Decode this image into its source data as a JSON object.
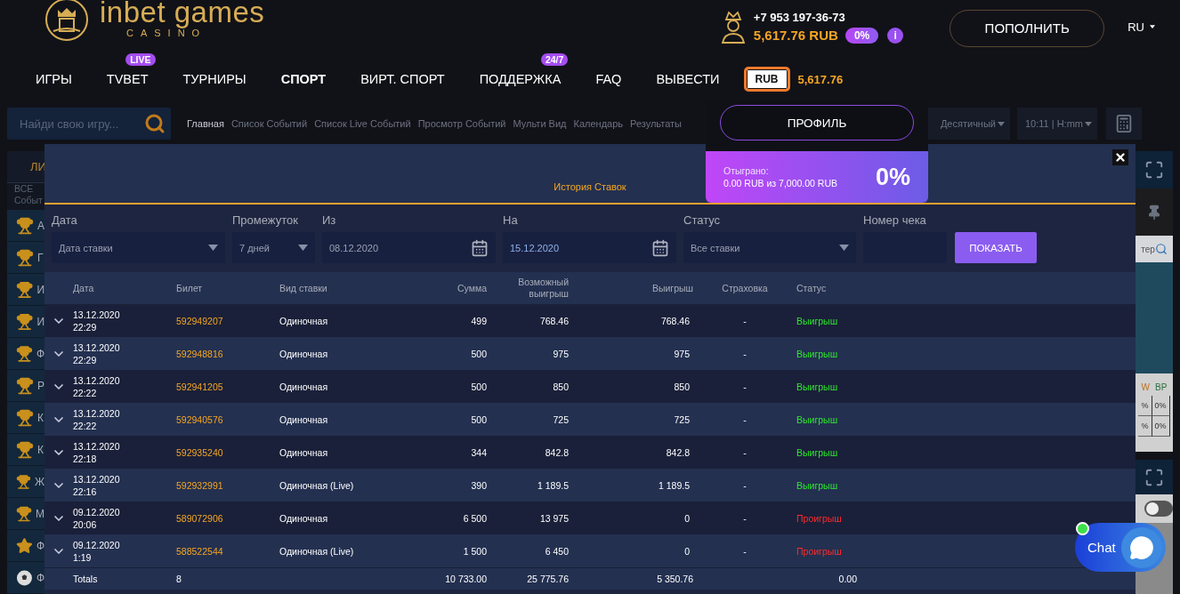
{
  "header": {
    "logo": {
      "name": "inbet games",
      "sub": "CASINO"
    },
    "account": {
      "phone": "+7 953 197-36-73",
      "balance": "5,617.76 RUB",
      "bonus": "0%",
      "info": "i"
    },
    "deposit_button": "ПОПОЛНИТЬ",
    "language": "RU"
  },
  "nav": {
    "items": [
      {
        "label": "ИГРЫ",
        "selected": false
      },
      {
        "label": "TVBET",
        "selected": false,
        "badge": "LIVE"
      },
      {
        "label": "ТУРНИРЫ",
        "selected": false
      },
      {
        "label": "СПОРТ",
        "selected": true
      },
      {
        "label": "ВИРТ. СПОРТ",
        "selected": false
      },
      {
        "label": "ПОДДЕРЖКА",
        "selected": false,
        "badge": "24/7"
      },
      {
        "label": "FAQ",
        "selected": false
      },
      {
        "label": "ВЫВЕСТИ",
        "selected": false
      }
    ],
    "currency_button": "RUB",
    "currency_balance": "5,617.76"
  },
  "subbar": {
    "search": {
      "placeholder": "Найди свою игру..."
    },
    "breadcrumbs": [
      {
        "label": "Главная",
        "selected": true
      },
      {
        "label": "Список Событий",
        "selected": false
      },
      {
        "label": "Список Live Событий",
        "selected": false
      },
      {
        "label": "Просмотр Событий",
        "selected": false
      },
      {
        "label": "Мульти Вид",
        "selected": false
      },
      {
        "label": "Календарь",
        "selected": false
      },
      {
        "label": "Результаты",
        "selected": false
      }
    ],
    "odds_format": "Десятичный",
    "time_format": "10:11 | H:mm"
  },
  "sidebar": {
    "header": "ЛИ",
    "all_events": [
      "ВСЕ",
      "Событ"
    ],
    "items": [
      {
        "kind": "trophy",
        "label": "А"
      },
      {
        "kind": "trophy",
        "label": "Г"
      },
      {
        "kind": "trophy",
        "label": "И"
      },
      {
        "kind": "trophy",
        "label": "И"
      },
      {
        "kind": "trophy",
        "label": "Ф"
      },
      {
        "kind": "trophy",
        "label": "Р"
      },
      {
        "kind": "trophy",
        "label": "К"
      },
      {
        "kind": "trophy",
        "label": "К"
      },
      {
        "kind": "trophy",
        "label": "Ж"
      },
      {
        "kind": "trophy",
        "label": "М"
      },
      {
        "kind": "star",
        "label": "Ф"
      },
      {
        "kind": "ball",
        "label": "Ф"
      }
    ]
  },
  "right_panel": {
    "filter_text": "тер",
    "columns": [
      "W",
      "BP"
    ],
    "cells": [
      [
        "%",
        "0%"
      ],
      [
        "%",
        "0%"
      ]
    ],
    "toggle": {
      "on": false
    }
  },
  "profile_menu": {
    "button": "ПРОФИЛЬ",
    "wagered_label": "Отыграно:",
    "wagered_amount": "0.00 RUB из 7,000.00 RUB",
    "percent": "0%"
  },
  "modal": {
    "title": "История Ставок",
    "filters": [
      {
        "kind": "select",
        "label": "Дата",
        "value": "Дата ставки"
      },
      {
        "kind": "select",
        "label": "Промежуток",
        "value": "7 дней"
      },
      {
        "kind": "date",
        "label": "Из",
        "value": "08.12.2020"
      },
      {
        "kind": "date",
        "label": "На",
        "value": "15.12.2020"
      },
      {
        "kind": "select",
        "label": "Статус",
        "value": "Все ставки"
      },
      {
        "kind": "text",
        "label": "Номер чека"
      }
    ],
    "show_button": "ПОКАЗАТЬ",
    "columns": [
      "Дата",
      "Билет",
      "Вид ставки",
      "Сумма",
      "Возможный выигрыш",
      "Выигрыш",
      "Страховка",
      "Статус"
    ],
    "rows": [
      {
        "date": "13.12.2020",
        "time": "22:29",
        "ticket": "592949207",
        "type": "Одиночная",
        "stake": "499",
        "possible": "768.46",
        "win": "768.46",
        "insurance": "-",
        "status": "Выигрыш",
        "kind": "won"
      },
      {
        "date": "13.12.2020",
        "time": "22:29",
        "ticket": "592948816",
        "type": "Одиночная",
        "stake": "500",
        "possible": "975",
        "win": "975",
        "insurance": "-",
        "status": "Выигрыш",
        "kind": "won"
      },
      {
        "date": "13.12.2020",
        "time": "22:22",
        "ticket": "592941205",
        "type": "Одиночная",
        "stake": "500",
        "possible": "850",
        "win": "850",
        "insurance": "-",
        "status": "Выигрыш",
        "kind": "won"
      },
      {
        "date": "13.12.2020",
        "time": "22:22",
        "ticket": "592940576",
        "type": "Одиночная",
        "stake": "500",
        "possible": "725",
        "win": "725",
        "insurance": "-",
        "status": "Выигрыш",
        "kind": "won"
      },
      {
        "date": "13.12.2020",
        "time": "22:18",
        "ticket": "592935240",
        "type": "Одиночная",
        "stake": "344",
        "possible": "842.8",
        "win": "842.8",
        "insurance": "-",
        "status": "Выигрыш",
        "kind": "won"
      },
      {
        "date": "13.12.2020",
        "time": "22:16",
        "ticket": "592932991",
        "type": "Одиночная (Live)",
        "stake": "390",
        "possible": "1 189.5",
        "win": "1 189.5",
        "insurance": "-",
        "status": "Выигрыш",
        "kind": "won"
      },
      {
        "date": "09.12.2020",
        "time": "20:06",
        "ticket": "589072906",
        "type": "Одиночная",
        "stake": "6 500",
        "possible": "13 975",
        "win": "0",
        "insurance": "-",
        "status": "Проигрыш",
        "kind": "lost"
      },
      {
        "date": "09.12.2020",
        "time": "1:19",
        "ticket": "588522544",
        "type": "Одиночная (Live)",
        "stake": "1 500",
        "possible": "6 450",
        "win": "0",
        "insurance": "-",
        "status": "Проигрыш",
        "kind": "lost"
      }
    ],
    "totals": {
      "label": "Totals",
      "count": "8",
      "stake": "10 733.00",
      "possible": "25 775.76",
      "win": "5 350.76",
      "insurance": "0.00"
    }
  },
  "chat": {
    "label": "Chat",
    "online": true
  }
}
